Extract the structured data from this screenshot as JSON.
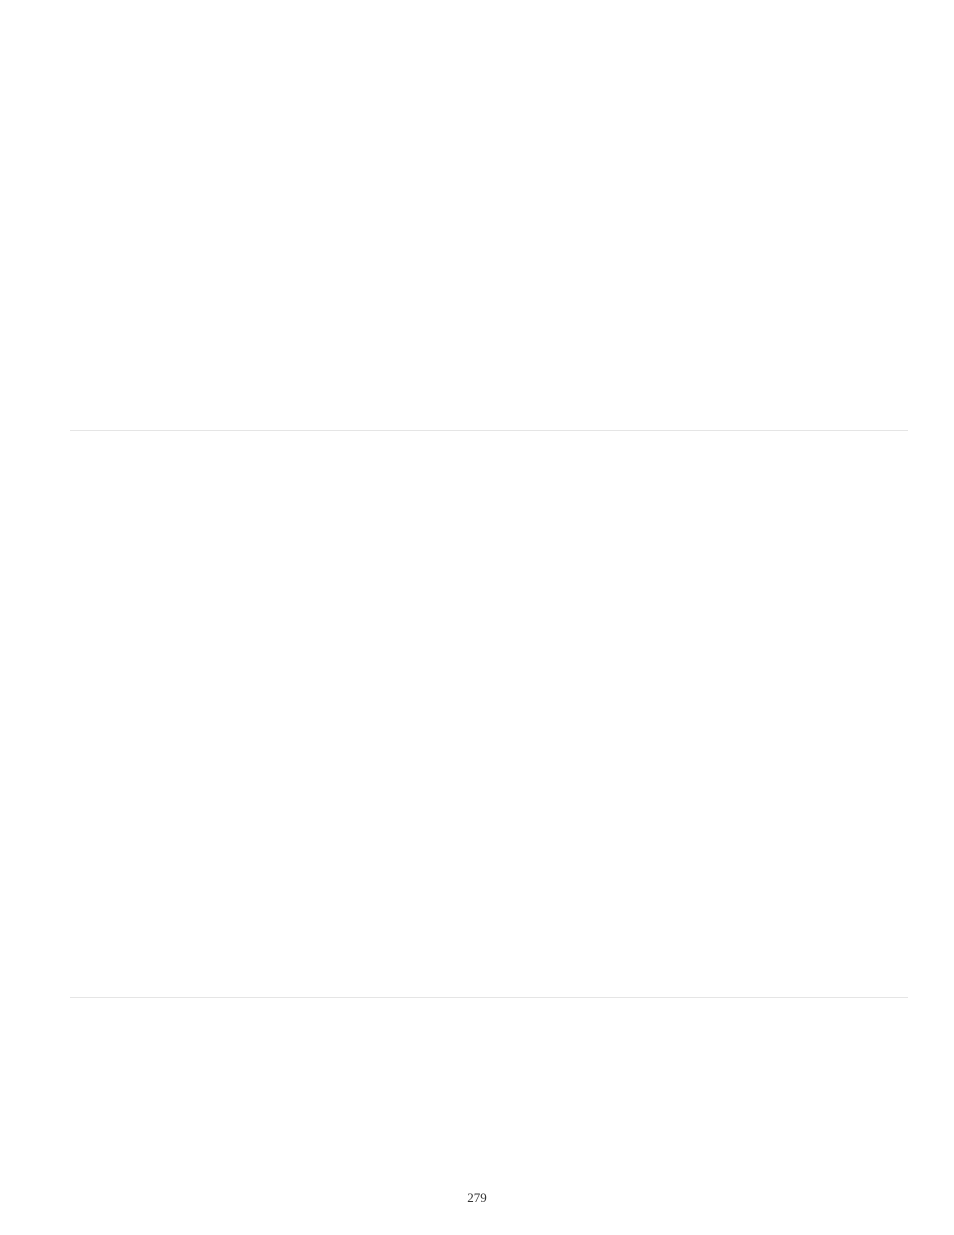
{
  "page": {
    "number": "279"
  }
}
